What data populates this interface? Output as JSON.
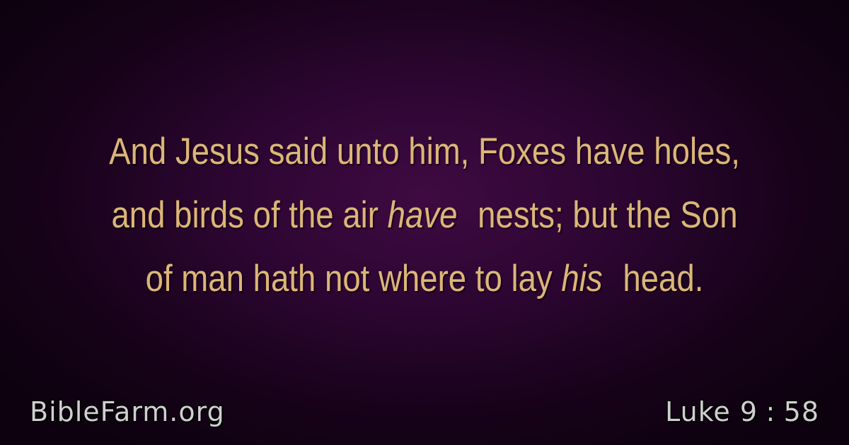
{
  "verse": {
    "line1": "And Jesus said unto him, Foxes have holes,",
    "line2_start": "and birds of the air",
    "line2_italic": "have",
    "line2_end": "nests; but the Son",
    "line3_start": "of man hath not where to lay",
    "line3_italic": "his",
    "line3_end": "head."
  },
  "footer": {
    "site": "BibleFarm.org",
    "book_chapter": "Luke 9",
    "separator": ":",
    "verse_number": "58"
  },
  "colors": {
    "verse_text": "#dcb677",
    "footer_text": "#cfcfcf",
    "background_center": "#3f0a42",
    "background_edge": "#0d010f"
  }
}
